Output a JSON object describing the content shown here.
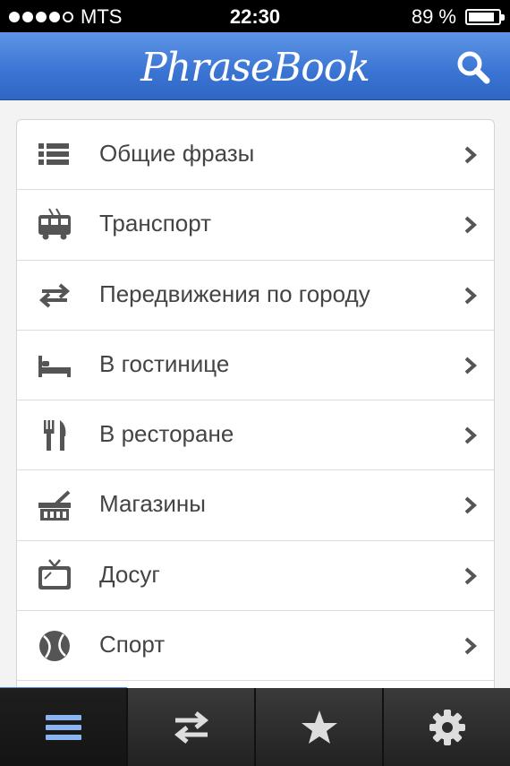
{
  "status_bar": {
    "carrier": "MTS",
    "signal_bars": 4,
    "signal_max": 5,
    "time": "22:30",
    "battery_text": "89 %",
    "battery_level": 0.89
  },
  "nav": {
    "title": "PhraseBook",
    "search_icon": "search-icon"
  },
  "categories": [
    {
      "label": "Общие фразы",
      "icon": "list-icon"
    },
    {
      "label": "Транспорт",
      "icon": "trolleybus-icon"
    },
    {
      "label": "Передвижения по городу",
      "icon": "arrows-left-right-icon"
    },
    {
      "label": "В гостинице",
      "icon": "bed-icon"
    },
    {
      "label": "В ресторане",
      "icon": "fork-knife-icon"
    },
    {
      "label": "Магазины",
      "icon": "shop-icon"
    },
    {
      "label": "Досуг",
      "icon": "tv-icon"
    },
    {
      "label": "Спорт",
      "icon": "ball-icon"
    }
  ],
  "tabs": [
    {
      "icon": "menu-icon",
      "active": true
    },
    {
      "icon": "swap-arrows-icon",
      "active": false
    },
    {
      "icon": "star-icon",
      "active": false
    },
    {
      "icon": "gear-icon",
      "active": false
    }
  ],
  "colors": {
    "nav_blue": "#3a74d3",
    "accent": "#4a8ae8",
    "icon_gray": "#555555",
    "text": "#444444"
  }
}
